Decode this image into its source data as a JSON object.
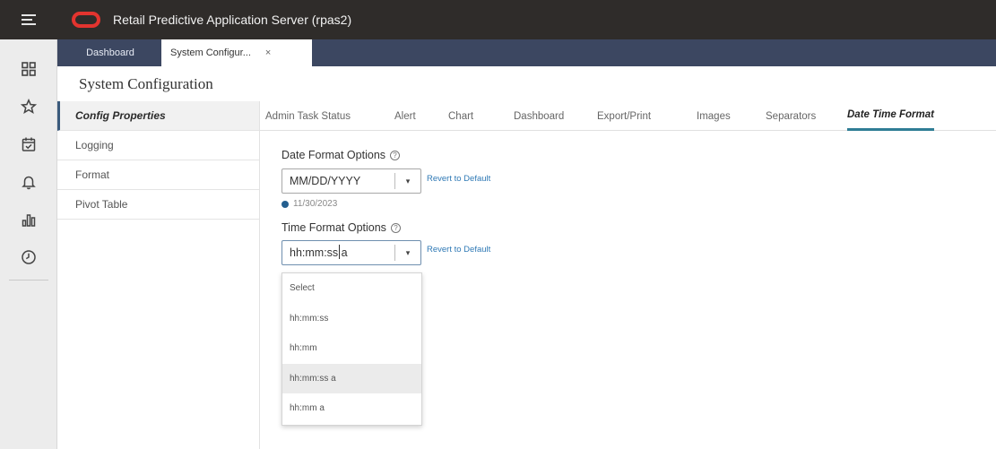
{
  "app": {
    "title": "Retail Predictive Application Server (rpas2)"
  },
  "doc_tabs": [
    {
      "label": "Dashboard"
    },
    {
      "label": "System Configur...",
      "close": "×"
    }
  ],
  "page": {
    "title": "System Configuration"
  },
  "nav": {
    "items": [
      {
        "label": "Config Properties"
      },
      {
        "label": "Logging"
      },
      {
        "label": "Format"
      },
      {
        "label": "Pivot Table"
      }
    ]
  },
  "sub_tabs": [
    {
      "label": "Admin Task Status"
    },
    {
      "label": "Alert"
    },
    {
      "label": "Chart"
    },
    {
      "label": "Dashboard"
    },
    {
      "label": "Export/Print"
    },
    {
      "label": "Images"
    },
    {
      "label": "Separators"
    },
    {
      "label": "Date Time Format"
    }
  ],
  "date_format": {
    "label": "Date Format Options",
    "value": "MM/DD/YYYY",
    "revert": "Revert to Default",
    "example": "11/30/2023"
  },
  "time_format": {
    "label": "Time Format Options",
    "value": "hh:mm:ss a",
    "revert": "Revert to Default",
    "options": [
      "Select",
      "hh:mm:ss",
      "hh:mm",
      "hh:mm:ss a",
      "hh:mm a"
    ]
  },
  "icons": {
    "help": "?",
    "caret": "▾"
  },
  "colors": {
    "header": "#2f2c2a",
    "doc_tab_bar": "#3c4761",
    "logo": "#e3342f",
    "link": "#2f79b5",
    "active_tab_underline": "#2f7d95"
  }
}
